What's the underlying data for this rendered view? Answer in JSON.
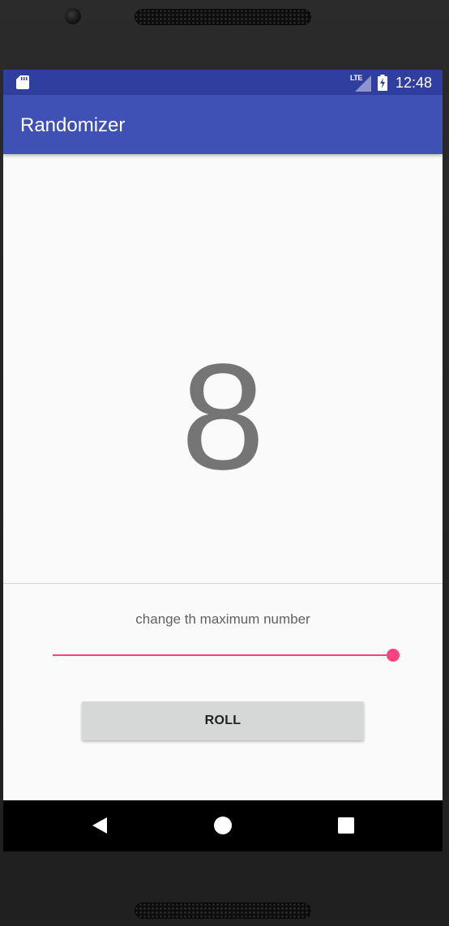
{
  "status_bar": {
    "time": "12:48",
    "network_label": "LTE",
    "icons": [
      "sd-card-icon",
      "lte-signal-icon",
      "battery-charging-icon"
    ]
  },
  "app_bar": {
    "title": "Randomizer"
  },
  "main": {
    "result_number": "8",
    "slider_label": "change th maximum number",
    "slider_value_fraction": 1.0,
    "roll_button_label": "ROLL"
  },
  "nav_bar": {
    "buttons": [
      "back-icon",
      "home-icon",
      "recents-icon"
    ]
  },
  "colors": {
    "status_bar": "#303f9f",
    "app_bar": "#3f51b5",
    "accent": "#ff4081",
    "number_text": "#757575",
    "button_bg": "#d6d7d7",
    "background": "#fafafa"
  }
}
